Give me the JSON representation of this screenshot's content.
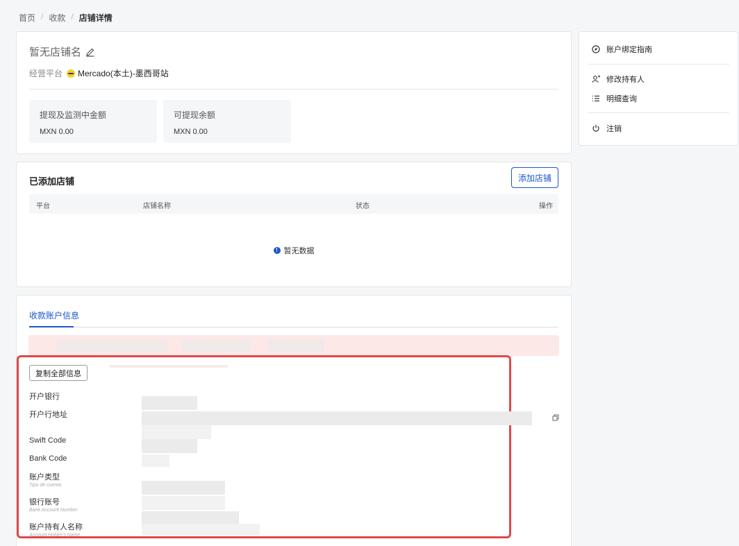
{
  "breadcrumb": {
    "home": "首页",
    "collect": "收款",
    "current": "店铺详情",
    "sep": "/"
  },
  "shop": {
    "name": "暂无店铺名",
    "platform_label": "经营平台",
    "platform_value": "Mercado(本土)-墨西哥站",
    "stats": [
      {
        "label": "提现及监测中金额",
        "value": "MXN 0.00"
      },
      {
        "label": "可提现余额",
        "value": "MXN 0.00"
      }
    ]
  },
  "stores": {
    "title": "已添加店铺",
    "add_button": "添加店铺",
    "columns": {
      "platform": "平台",
      "shop_name": "店铺名称",
      "status": "状态",
      "action": "操作"
    },
    "empty_text": "暂无数据"
  },
  "account": {
    "tab": "收款账户信息",
    "copy_all": "复制全部信息",
    "fields": {
      "bank": "开户银行",
      "bank_address": "开户行地址",
      "swift": "Swift Code",
      "bank_code": "Bank Code",
      "acct_type": "账户类型",
      "acct_type_sub": "Tipo de cuenta",
      "acct_no": "银行账号",
      "acct_no_sub": "Bank Account Number",
      "holder": "账户持有人名称",
      "holder_sub": "Account Holder's Name"
    }
  },
  "sidebar": {
    "items": [
      "账户绑定指南",
      "修改持有人",
      "明细查询",
      "注销"
    ]
  },
  "colors": {
    "accent": "#1a56c8",
    "highlight": "#e04848",
    "warning_bg": "#fde8e8"
  }
}
